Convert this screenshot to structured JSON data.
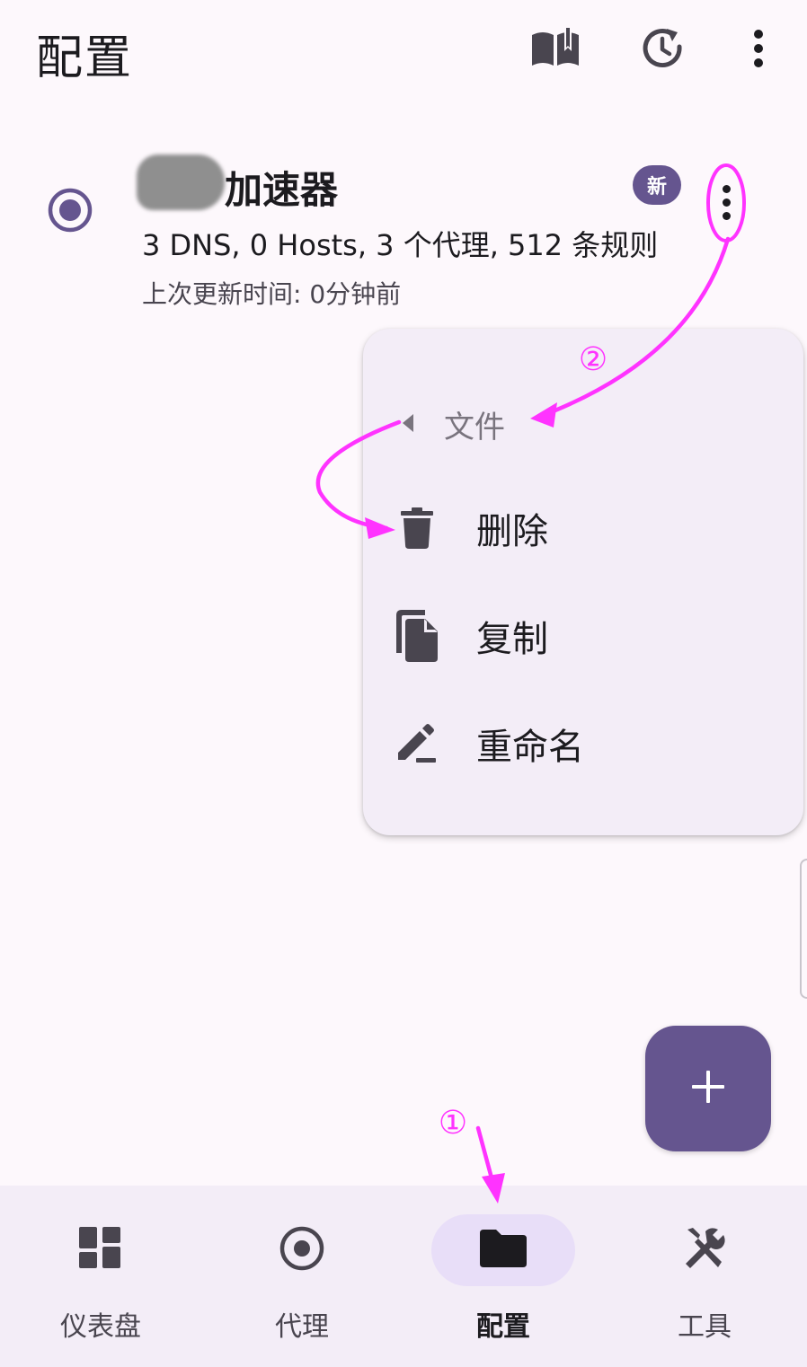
{
  "app_bar": {
    "title": "配置",
    "icons": [
      "book-open-icon",
      "history-refresh-icon",
      "more-vert-icon"
    ]
  },
  "profile": {
    "name": "加速器",
    "badge": "新",
    "stats": "3 DNS, 0 Hosts, 3 个代理, 512 条规则",
    "updated": "上次更新时间: 0分钟前",
    "selected": true
  },
  "menu": {
    "back_label": "文件",
    "items": [
      {
        "label": "删除",
        "icon": "delete-icon"
      },
      {
        "label": "复制",
        "icon": "copy-icon"
      },
      {
        "label": "重命名",
        "icon": "edit-icon"
      }
    ]
  },
  "fab": {
    "icon": "plus-icon"
  },
  "bottom_nav": {
    "items": [
      {
        "label": "仪表盘",
        "icon": "dashboard-icon"
      },
      {
        "label": "代理",
        "icon": "radio-target-icon"
      },
      {
        "label": "配置",
        "icon": "folder-icon",
        "active": true
      },
      {
        "label": "工具",
        "icon": "tools-icon"
      }
    ]
  },
  "annotations": {
    "step1": "①",
    "step2": "②",
    "color": "#ff33ff"
  },
  "colors": {
    "primary": "#65558f",
    "background": "#fdf8fc",
    "surface_container": "#f3edf7",
    "active_indicator": "#e8def8"
  }
}
